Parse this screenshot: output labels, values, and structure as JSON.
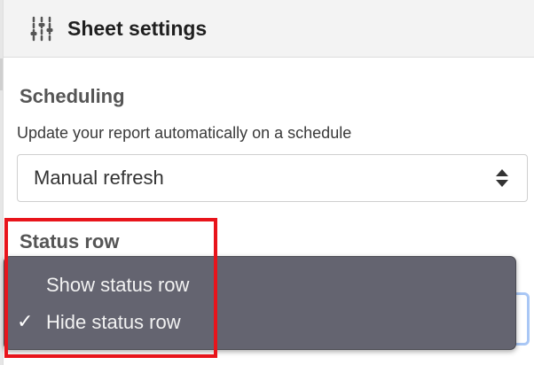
{
  "header": {
    "icon": "sliders-icon",
    "title": "Sheet settings"
  },
  "scheduling": {
    "title": "Scheduling",
    "description": "Update your report automatically on a schedule",
    "select_value": "Manual refresh",
    "select_icon": "up-down-arrows-icon"
  },
  "status_row": {
    "title": "Status row",
    "options": [
      {
        "label": "Show status row",
        "checked": false
      },
      {
        "label": "Hide status row",
        "checked": true
      }
    ],
    "check_mark": "✓"
  },
  "colors": {
    "dropdown_bg": "#646470",
    "annotation_border": "#e8141b",
    "focus_ring": "#a9c7f5"
  }
}
